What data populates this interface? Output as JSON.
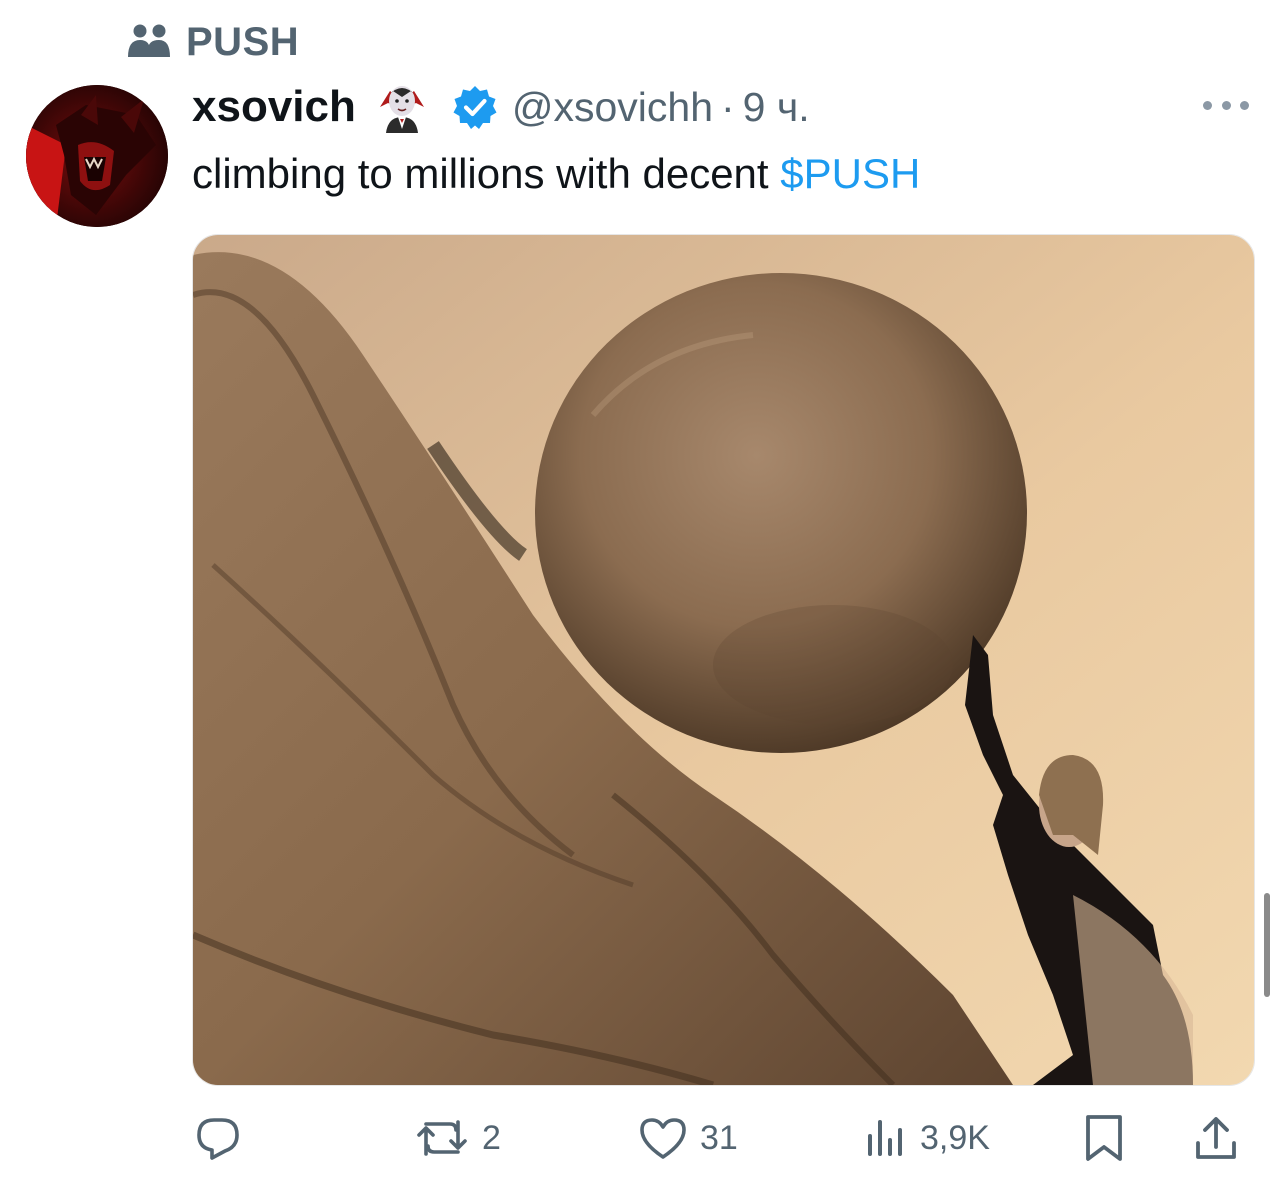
{
  "community": {
    "label": "PUSH",
    "icon": "community-icon"
  },
  "post": {
    "author_name": "xsovich",
    "author_emoji": "vampire-emoji",
    "verified_icon": "verified-badge-icon",
    "handle": "@xsovichh",
    "separator": "·",
    "time": "9 ч.",
    "text_prefix": "climbing to millions with decent ",
    "cashtag": "$PUSH",
    "more_icon": "more-options-icon",
    "media_alt": "sisyphus-meme-image"
  },
  "actions": {
    "reply": {
      "icon": "reply-icon",
      "count": ""
    },
    "repost": {
      "icon": "repost-icon",
      "count": "2"
    },
    "like": {
      "icon": "like-icon",
      "count": "31"
    },
    "views": {
      "icon": "views-icon",
      "count": "3,9K"
    },
    "bookmark": {
      "icon": "bookmark-icon"
    },
    "share": {
      "icon": "share-icon"
    }
  },
  "colors": {
    "accent": "#1d9bf0",
    "secondary_text": "#536471",
    "primary_text": "#0f1419"
  }
}
